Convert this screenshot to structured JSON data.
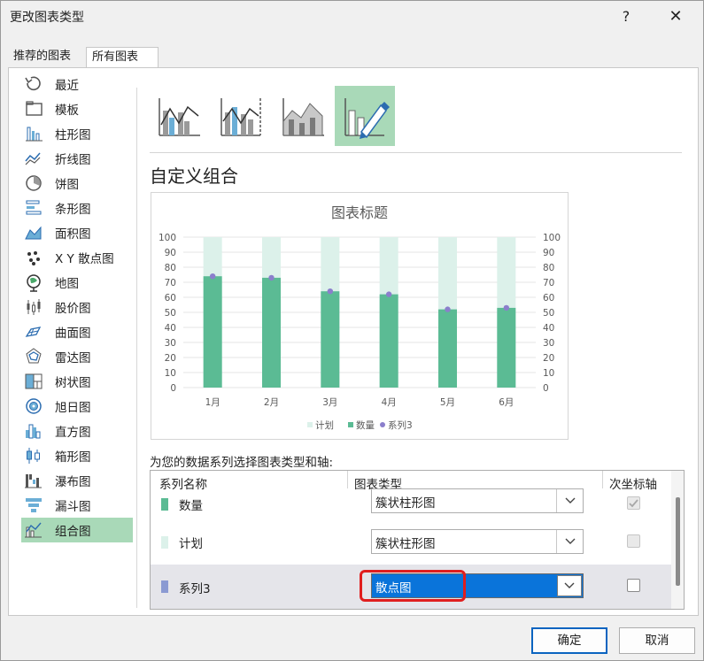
{
  "window": {
    "title": "更改图表类型",
    "help": "?",
    "close": "✕"
  },
  "tabs": [
    {
      "label": "推荐的图表"
    },
    {
      "label": "所有图表"
    }
  ],
  "sidebar": {
    "items": [
      {
        "label": "最近",
        "icon": "recent-icon"
      },
      {
        "label": "模板",
        "icon": "folder-icon"
      },
      {
        "label": "柱形图",
        "icon": "column-chart-icon"
      },
      {
        "label": "折线图",
        "icon": "line-chart-icon"
      },
      {
        "label": "饼图",
        "icon": "pie-chart-icon"
      },
      {
        "label": "条形图",
        "icon": "bar-chart-icon"
      },
      {
        "label": "面积图",
        "icon": "area-chart-icon"
      },
      {
        "label": "X Y 散点图",
        "icon": "scatter-chart-icon"
      },
      {
        "label": "地图",
        "icon": "map-chart-icon"
      },
      {
        "label": "股价图",
        "icon": "stock-chart-icon"
      },
      {
        "label": "曲面图",
        "icon": "surface-chart-icon"
      },
      {
        "label": "雷达图",
        "icon": "radar-chart-icon"
      },
      {
        "label": "树状图",
        "icon": "treemap-chart-icon"
      },
      {
        "label": "旭日图",
        "icon": "sunburst-chart-icon"
      },
      {
        "label": "直方图",
        "icon": "histogram-chart-icon"
      },
      {
        "label": "箱形图",
        "icon": "box-whisker-chart-icon"
      },
      {
        "label": "瀑布图",
        "icon": "waterfall-chart-icon"
      },
      {
        "label": "漏斗图",
        "icon": "funnel-chart-icon"
      },
      {
        "label": "组合图",
        "icon": "combo-chart-icon"
      }
    ],
    "active_index": 18
  },
  "combo_subtypes": [
    {
      "icon": "clustered-column-line-icon"
    },
    {
      "icon": "clustered-column-line-secondary-axis-icon"
    },
    {
      "icon": "stacked-area-clustered-column-icon"
    },
    {
      "icon": "custom-combination-icon"
    }
  ],
  "section_title": "自定义组合",
  "chart_data": {
    "type": "bar",
    "title": "图表标题",
    "categories": [
      "1月",
      "2月",
      "3月",
      "4月",
      "5月",
      "6月"
    ],
    "series": [
      {
        "name": "计划",
        "type": "bar",
        "values": [
          100,
          100,
          100,
          100,
          100,
          100
        ]
      },
      {
        "name": "数量",
        "type": "bar",
        "values": [
          74,
          73,
          64,
          62,
          52,
          53
        ]
      },
      {
        "name": "系列3",
        "type": "scatter",
        "values": [
          74,
          73,
          64,
          62,
          52,
          53
        ]
      }
    ],
    "ylim": [
      0,
      100
    ],
    "yticks": [
      0,
      10,
      20,
      30,
      40,
      50,
      60,
      70,
      80,
      90,
      100
    ],
    "secondary_ylim": [
      0,
      100
    ],
    "grid": true,
    "legend": "bottom",
    "colors": {
      "计划": "#dcf1ea",
      "数量": "#5bbb94",
      "系列3": "#8b7fcc"
    }
  },
  "series_panel": {
    "caption": "为您的数据系列选择图表类型和轴:",
    "headers": {
      "name": "系列名称",
      "type": "图表类型",
      "secondary": "次坐标轴"
    },
    "rows": [
      {
        "name": "数量",
        "type": "簇状柱形图",
        "color": "#5bbb94",
        "secondary": true,
        "secondary_enabled": false
      },
      {
        "name": "计划",
        "type": "簇状柱形图",
        "color": "#dcf1ea",
        "secondary": false,
        "secondary_enabled": false
      },
      {
        "name": "系列3",
        "type": "散点图",
        "color": "#8b9ad2",
        "secondary": false,
        "secondary_enabled": true
      }
    ]
  },
  "buttons": {
    "ok": "确定",
    "cancel": "取消"
  }
}
